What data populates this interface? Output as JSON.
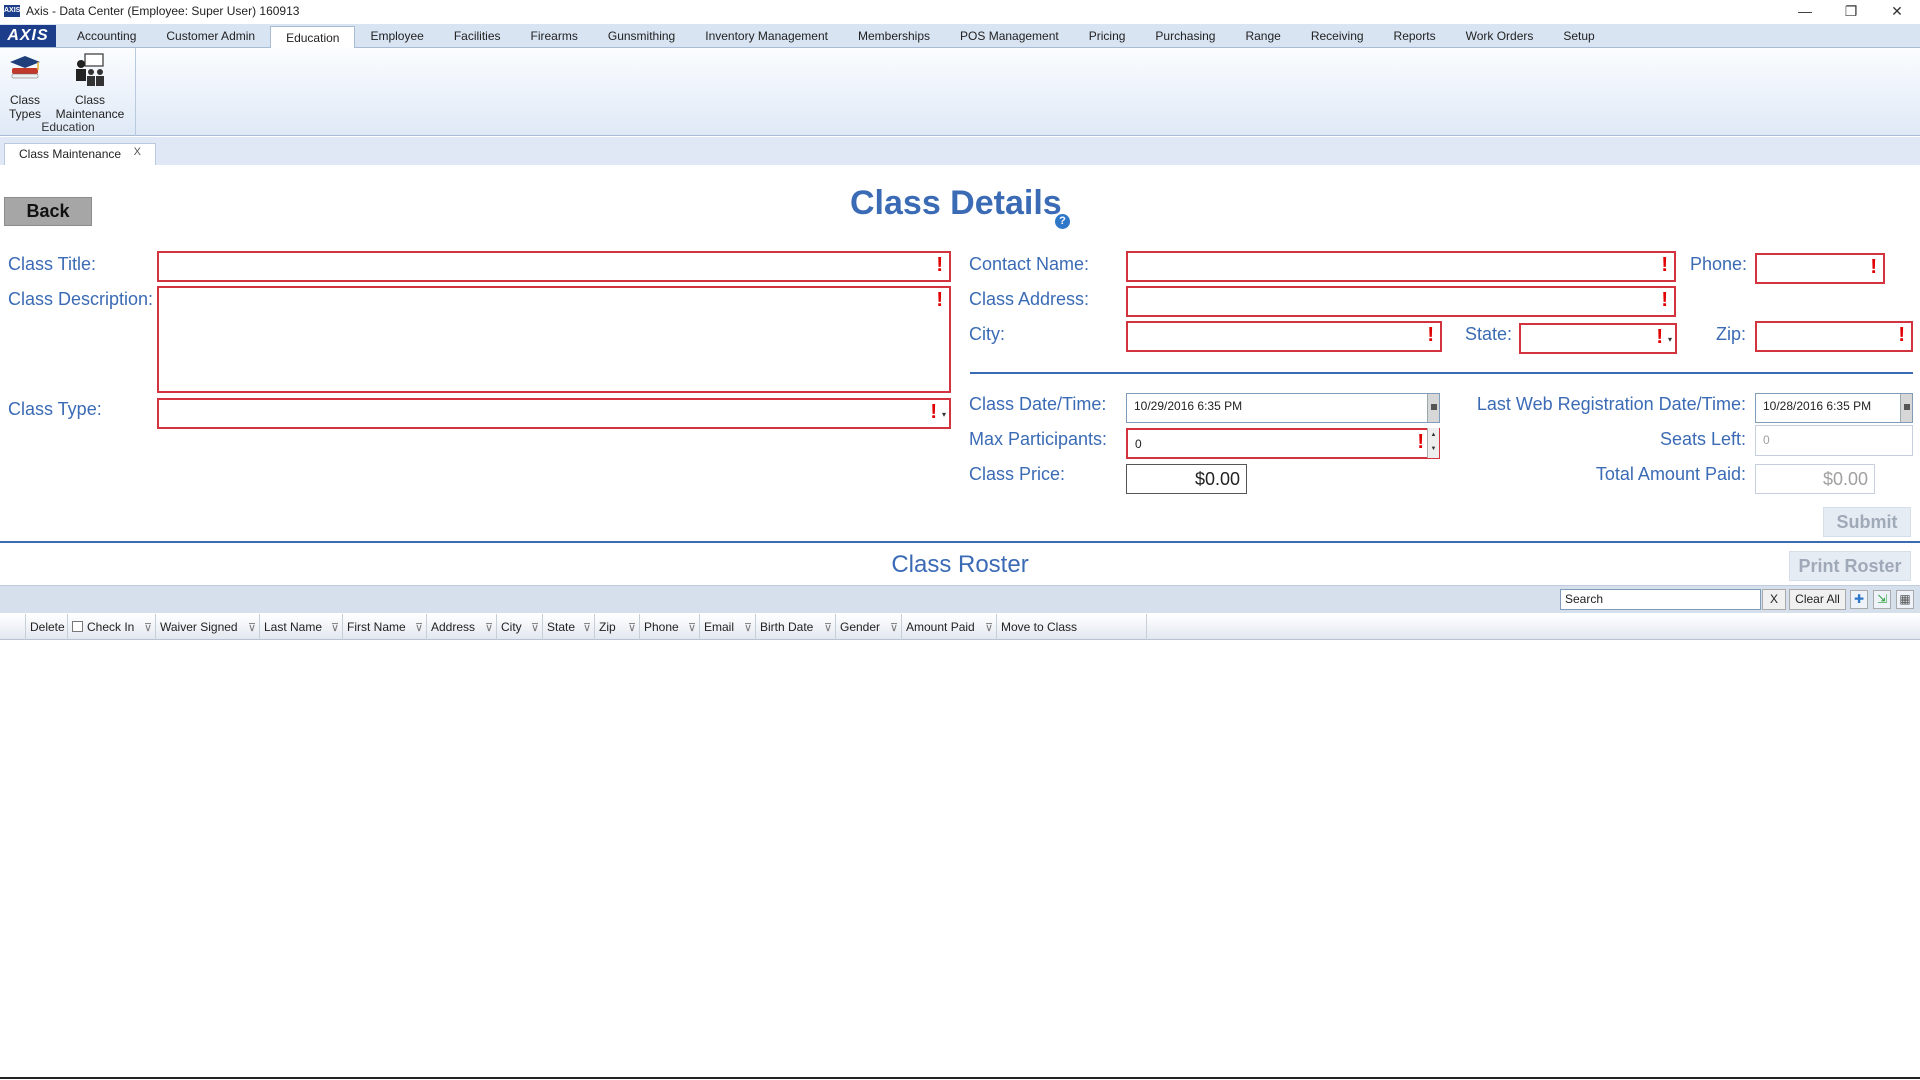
{
  "window": {
    "title": "Axis - Data Center  (Employee: Super User) 160913",
    "logo": "AXIS",
    "controls": {
      "minimize": "—",
      "restore": "❐",
      "close": "✕"
    }
  },
  "menu": {
    "tabs": [
      "Accounting",
      "Customer Admin",
      "Education",
      "Employee",
      "Facilities",
      "Firearms",
      "Gunsmithing",
      "Inventory Management",
      "Memberships",
      "POS Management",
      "Pricing",
      "Purchasing",
      "Range",
      "Receiving",
      "Reports",
      "Work Orders",
      "Setup"
    ],
    "active": "Education"
  },
  "ribbon": {
    "class_types": "Class Types",
    "class_maintenance": "Class Maintenance",
    "group_label": "Education"
  },
  "doc_tab": {
    "label": "Class Maintenance",
    "close": "X"
  },
  "form": {
    "back": "Back",
    "title": "Class Details",
    "help": "?",
    "labels": {
      "class_title": "Class Title:",
      "class_description": "Class Description:",
      "class_type": "Class Type:",
      "contact_name": "Contact Name:",
      "phone": "Phone:",
      "class_address": "Class Address:",
      "city": "City:",
      "state": "State:",
      "zip": "Zip:",
      "class_datetime": "Class Date/Time:",
      "last_web_reg": "Last Web Registration Date/Time:",
      "max_participants": "Max Participants:",
      "seats_left": "Seats Left:",
      "class_price": "Class Price:",
      "total_amount_paid": "Total Amount Paid:"
    },
    "values": {
      "class_datetime": "10/29/2016 6:35 PM",
      "last_web_reg": "10/28/2016 6:35 PM",
      "max_participants": "0",
      "seats_left": "0",
      "class_price": "$0.00",
      "total_amount_paid": "$0.00"
    },
    "required_mark": "!",
    "submit": "Submit"
  },
  "roster": {
    "title": "Class Roster",
    "print": "Print Roster",
    "search_placeholder": "Search",
    "search_clear": "X",
    "clear_all": "Clear All",
    "columns": [
      "Delete",
      "Check In",
      "Waiver Signed",
      "Last Name",
      "First Name",
      "Address",
      "City",
      "State",
      "Zip",
      "Phone",
      "Email",
      "Birth Date",
      "Gender",
      "Amount Paid",
      "Move to Class"
    ]
  }
}
